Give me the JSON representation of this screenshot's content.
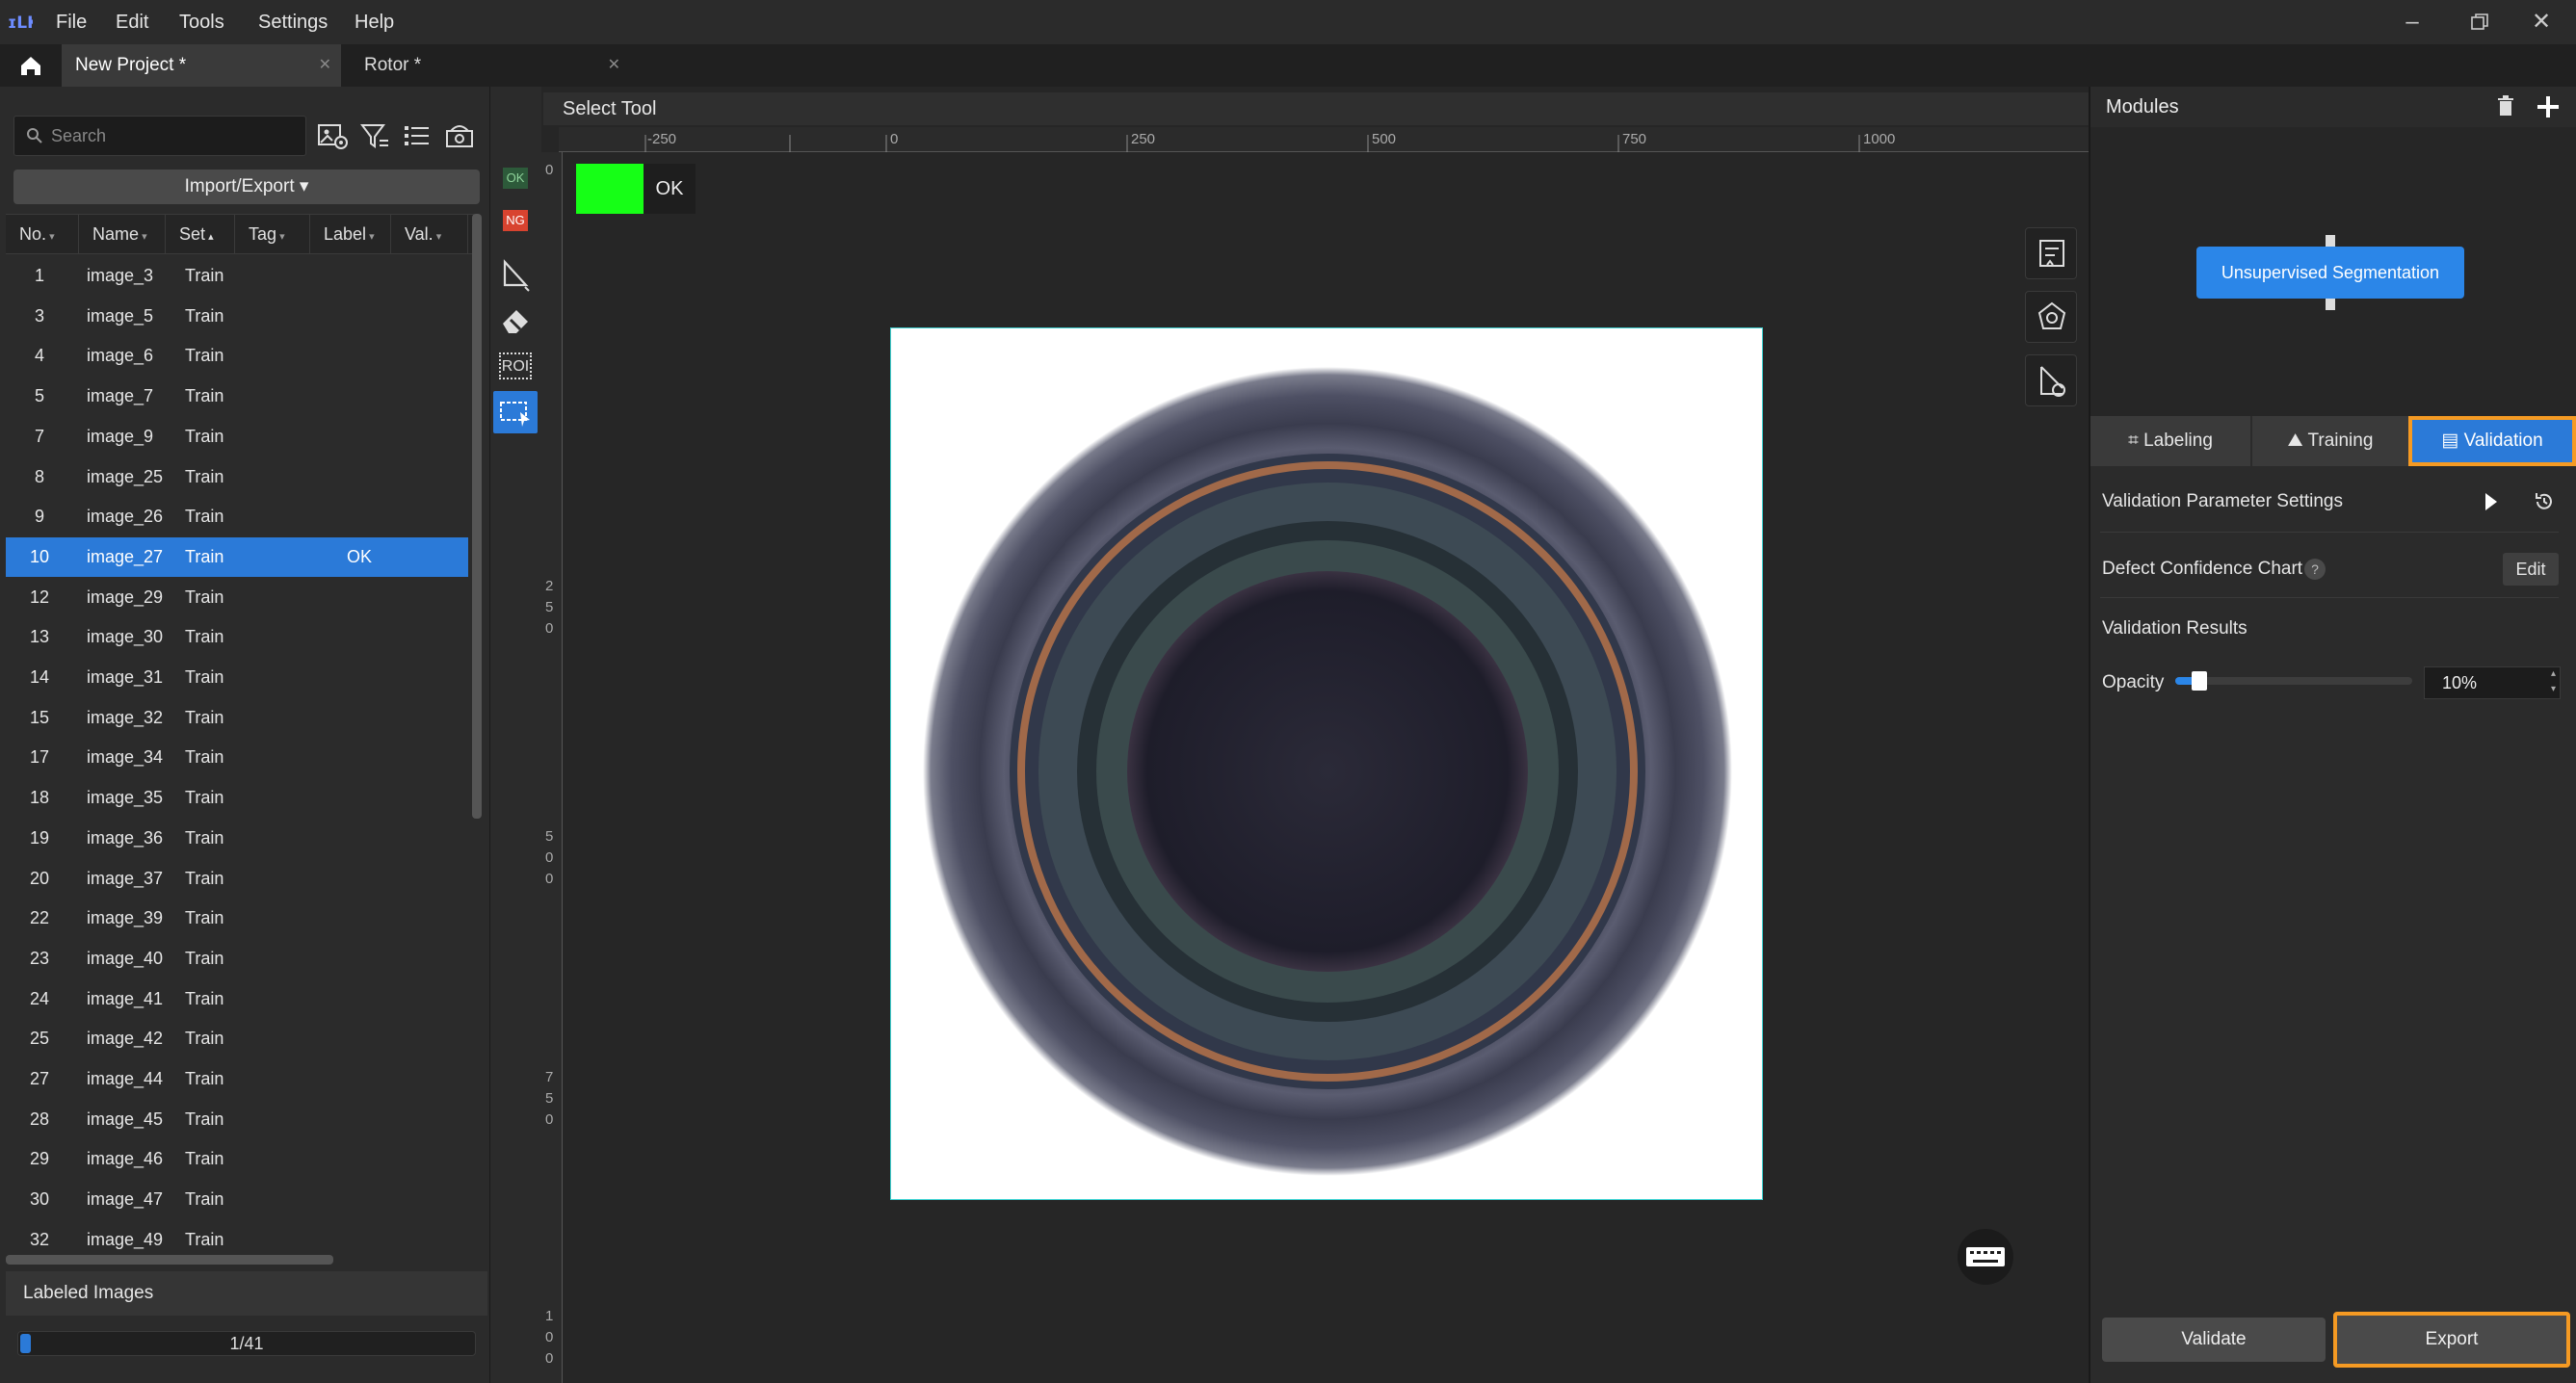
{
  "menu": {
    "items": [
      "File",
      "Edit",
      "Tools",
      "Settings",
      "Help"
    ]
  },
  "tabs": [
    {
      "label": "New Project *",
      "active": true
    },
    {
      "label": "Rotor *",
      "active": false
    }
  ],
  "left_panel": {
    "search_placeholder": "Search",
    "import_export_label": "Import/Export",
    "columns": [
      "No.",
      "Name",
      "Set",
      "Tag",
      "Label",
      "Val."
    ],
    "rows": [
      {
        "no": "1",
        "name": "image_3",
        "set": "Train",
        "label": ""
      },
      {
        "no": "3",
        "name": "image_5",
        "set": "Train",
        "label": ""
      },
      {
        "no": "4",
        "name": "image_6",
        "set": "Train",
        "label": ""
      },
      {
        "no": "5",
        "name": "image_7",
        "set": "Train",
        "label": ""
      },
      {
        "no": "7",
        "name": "image_9",
        "set": "Train",
        "label": ""
      },
      {
        "no": "8",
        "name": "image_25",
        "set": "Train",
        "label": ""
      },
      {
        "no": "9",
        "name": "image_26",
        "set": "Train",
        "label": ""
      },
      {
        "no": "10",
        "name": "image_27",
        "set": "Train",
        "label": "OK",
        "selected": true
      },
      {
        "no": "12",
        "name": "image_29",
        "set": "Train",
        "label": ""
      },
      {
        "no": "13",
        "name": "image_30",
        "set": "Train",
        "label": ""
      },
      {
        "no": "14",
        "name": "image_31",
        "set": "Train",
        "label": ""
      },
      {
        "no": "15",
        "name": "image_32",
        "set": "Train",
        "label": ""
      },
      {
        "no": "17",
        "name": "image_34",
        "set": "Train",
        "label": ""
      },
      {
        "no": "18",
        "name": "image_35",
        "set": "Train",
        "label": ""
      },
      {
        "no": "19",
        "name": "image_36",
        "set": "Train",
        "label": ""
      },
      {
        "no": "20",
        "name": "image_37",
        "set": "Train",
        "label": ""
      },
      {
        "no": "22",
        "name": "image_39",
        "set": "Train",
        "label": ""
      },
      {
        "no": "23",
        "name": "image_40",
        "set": "Train",
        "label": ""
      },
      {
        "no": "24",
        "name": "image_41",
        "set": "Train",
        "label": ""
      },
      {
        "no": "25",
        "name": "image_42",
        "set": "Train",
        "label": ""
      },
      {
        "no": "27",
        "name": "image_44",
        "set": "Train",
        "label": ""
      },
      {
        "no": "28",
        "name": "image_45",
        "set": "Train",
        "label": ""
      },
      {
        "no": "29",
        "name": "image_46",
        "set": "Train",
        "label": ""
      },
      {
        "no": "30",
        "name": "image_47",
        "set": "Train",
        "label": ""
      },
      {
        "no": "32",
        "name": "image_49",
        "set": "Train",
        "label": ""
      }
    ],
    "labeled_images_title": "Labeled Images",
    "labeled_progress_text": "1/41",
    "labeled_progress_fraction": 0.024
  },
  "tool_strip": {
    "ok_tag": "OK",
    "ng_tag": "NG",
    "roi_label": "ROI"
  },
  "canvas": {
    "title": "Select Tool",
    "ruler_top": [
      "-250",
      "0",
      "250",
      "500",
      "750",
      "1000"
    ],
    "ruler_left": [
      "0",
      "2 5 0",
      "5 0 0",
      "7 5 0",
      "1 0 0"
    ],
    "current_label": "OK",
    "label_color": "#16ff16"
  },
  "right_panel": {
    "modules_title": "Modules",
    "module_name": "Unsupervised Segmentation",
    "tabs": [
      "Labeling",
      "Training",
      "Validation"
    ],
    "active_tab": "Validation",
    "validation_param_settings": "Validation Parameter Settings",
    "defect_chart_label": "Defect Confidence Chart",
    "edit_label": "Edit",
    "help_glyph": "?",
    "validation_results_label": "Validation Results",
    "opacity_label": "Opacity",
    "opacity_value": "10%",
    "opacity_fraction": 0.1,
    "validate_label": "Validate",
    "export_label": "Export"
  },
  "colors": {
    "accent": "#2b7ad8",
    "highlight": "#f59a23",
    "background": "#232323"
  }
}
